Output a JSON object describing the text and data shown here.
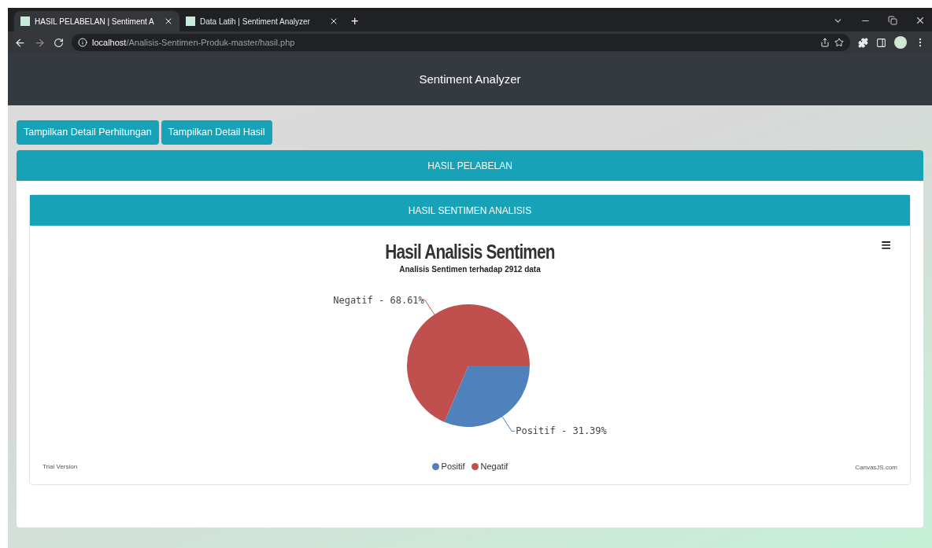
{
  "browser": {
    "tabs": [
      {
        "title": "HASIL PELABELAN | Sentiment A",
        "selected": true
      },
      {
        "title": "Data Latih | Sentiment Analyzer",
        "selected": false
      }
    ],
    "new_tab": "+",
    "address": {
      "host": "localhost",
      "path": "/Analisis-Sentimen-Produk-master/hasil.php"
    }
  },
  "navbar": {
    "brand": "Sentiment Analyzer"
  },
  "buttons": [
    "Tampilkan Detail Perhitungan",
    "Tampilkan Detail Hasil"
  ],
  "outer_card": {
    "header": "HASIL PELABELAN"
  },
  "inner_card": {
    "header": "HASIL SENTIMEN ANALISIS",
    "chart": {
      "menu": "≡",
      "trial": "Trial Version",
      "credit": "CanvasJS.com",
      "chart_data": {
        "type": "pie",
        "title": "Hasil Analisis Sentimen",
        "subtitle": "Analisis Sentimen terhadap 2912 data",
        "categories": [
          "Positif",
          "Negatif"
        ],
        "values": [
          31.39,
          68.61
        ],
        "colors": [
          "#4f81bc",
          "#c0504e"
        ],
        "legend": "bottom"
      },
      "slice_labels": [
        "Positif - 31.39%",
        "Negatif - 68.61%"
      ]
    }
  }
}
